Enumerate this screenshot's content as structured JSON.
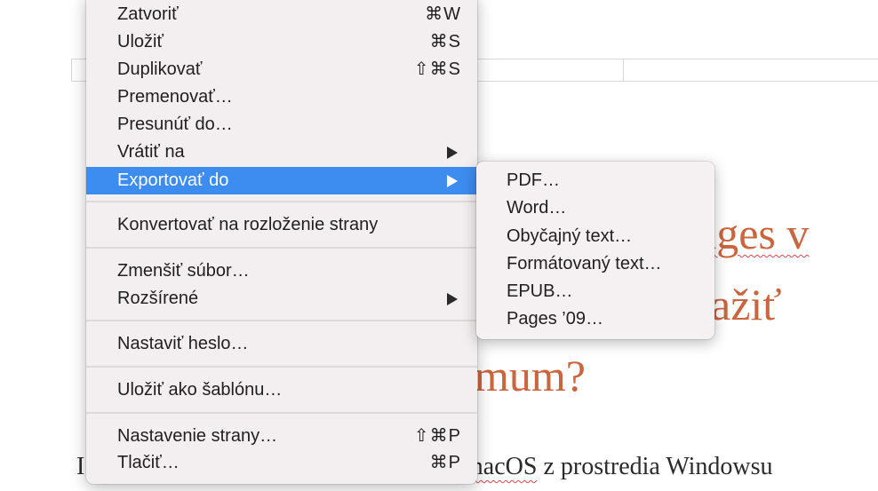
{
  "document": {
    "heading_line1": "ages v",
    "heading_line2": "ažiť",
    "heading_line3": "mum?",
    "body_start": "I",
    "body_word_macos": "macOS",
    "body_rest": " z prostredia Windowsu"
  },
  "menu": {
    "items": [
      {
        "label": "Zatvoriť",
        "shortcut": "⌘W"
      },
      {
        "label": "Uložiť",
        "shortcut": "⌘S"
      },
      {
        "label": "Duplikovať",
        "shortcut": "⇧⌘S"
      },
      {
        "label": "Premenovať…",
        "shortcut": ""
      },
      {
        "label": "Presunúť do…",
        "shortcut": ""
      },
      {
        "label": "Vrátiť na",
        "shortcut": ""
      },
      {
        "label": "Exportovať do",
        "shortcut": ""
      },
      {
        "label": "Konvertovať na rozloženie strany",
        "shortcut": ""
      },
      {
        "label": "Zmenšiť súbor…",
        "shortcut": ""
      },
      {
        "label": "Rozšírené",
        "shortcut": ""
      },
      {
        "label": "Nastaviť heslo…",
        "shortcut": ""
      },
      {
        "label": "Uložiť ako šablónu…",
        "shortcut": ""
      },
      {
        "label": "Nastavenie strany…",
        "shortcut": "⇧⌘P"
      },
      {
        "label": "Tlačiť…",
        "shortcut": "⌘P"
      }
    ]
  },
  "submenu": {
    "items": [
      {
        "label": "PDF…"
      },
      {
        "label": "Word…"
      },
      {
        "label": "Obyčajný text…"
      },
      {
        "label": "Formátovaný text…"
      },
      {
        "label": "EPUB…"
      },
      {
        "label": "Pages ’09…"
      }
    ]
  },
  "colors": {
    "highlight": "#3d8cf0",
    "heading": "#c9653f",
    "menu_background": "#f3eeef"
  }
}
